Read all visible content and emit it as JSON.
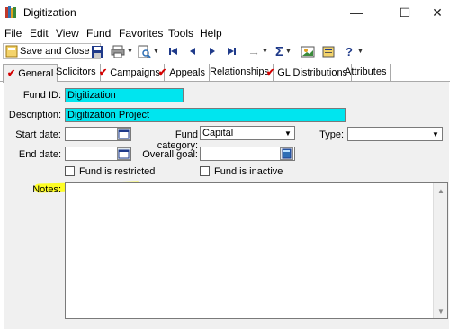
{
  "window": {
    "title": "Digitization",
    "minimize_glyph": "—",
    "maximize_glyph": "☐",
    "close_glyph": "✕"
  },
  "menu": [
    "File",
    "Edit",
    "View",
    "Fund",
    "Favorites",
    "Tools",
    "Help"
  ],
  "toolbar": {
    "save_close_label": "Save and Close",
    "sigma": "Σ",
    "help": "?",
    "arrow_right": "→"
  },
  "tabs": [
    {
      "label": "General",
      "checked": true,
      "active": true
    },
    {
      "label": "Solicitors",
      "checked": false
    },
    {
      "label": "Campaigns",
      "checked": true
    },
    {
      "label": "Appeals",
      "checked": true
    },
    {
      "label": "Relationships",
      "checked": false
    },
    {
      "label": "GL Distributions",
      "checked": true
    },
    {
      "label": "Attributes",
      "checked": false
    }
  ],
  "form": {
    "fund_id_label": "Fund ID:",
    "fund_id_value": "Digitization",
    "description_label": "Description:",
    "description_value": "Digitization Project",
    "start_date_label": "Start date:",
    "start_date_value": "",
    "end_date_label": "End date:",
    "end_date_value": "",
    "fund_category_label": "Fund category:",
    "fund_category_value": "Capital",
    "overall_goal_label": "Overall goal:",
    "overall_goal_value": "",
    "type_label": "Type:",
    "type_value": "",
    "restricted_label": "Fund is restricted",
    "restricted_checked": false,
    "inactive_label": "Fund is inactive",
    "inactive_checked": false,
    "notes_label": "Notes:",
    "notes_value": ""
  },
  "colors": {
    "field_highlight": "#00e5ef",
    "annotation_highlight": "#ffff00",
    "check_mark": "#d40000"
  }
}
